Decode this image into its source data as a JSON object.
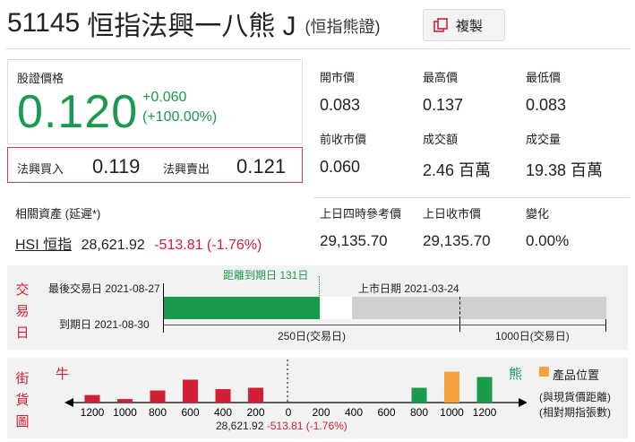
{
  "header": {
    "code": "51145",
    "name": "恒指法興一八熊 J",
    "paren": "(恒指熊證)",
    "copy_label": "複製"
  },
  "price": {
    "label": "股證價格",
    "value": "0.120",
    "change": "+0.060",
    "change_pct": "(+100.00%)"
  },
  "bidask": {
    "bid_label": "法興買入",
    "bid_value": "0.119",
    "ask_label": "法興賣出",
    "ask_value": "0.121"
  },
  "stats": {
    "open_label": "開市價",
    "open": "0.083",
    "high_label": "最高價",
    "high": "0.137",
    "low_label": "最低價",
    "low": "0.083",
    "prev_label": "前收市價",
    "prev": "0.060",
    "turnover_label": "成交額",
    "turnover": "2.46 百萬",
    "volume_label": "成交量",
    "volume": "19.38 百萬"
  },
  "related": {
    "label": "相關資產 (延遲*)",
    "asset": "HSI 恒指",
    "value": "28,621.92",
    "change": "-513.81 (-1.76%)",
    "ref_label": "上日四時參考價",
    "ref": "29,135.70",
    "close_label": "上日收市價",
    "close": "29,135.70",
    "diff_label": "變化",
    "diff": "0.00%"
  },
  "trading": {
    "side": [
      "交",
      "易",
      "日"
    ],
    "last_trade": "最後交易日 2021-08-27",
    "days_to_expiry": "距離到期日 131日",
    "listing": "上市日期 2021-03-24",
    "expiry": "到期日 2021-08-30",
    "scale_250": "250日(交易日)",
    "scale_1000": "1000日(交易日)",
    "progress_fraction": 0.48
  },
  "street": {
    "side": [
      "街",
      "貨",
      "圖"
    ],
    "bull": "牛",
    "bear": "熊",
    "legend": "產品位置",
    "note1": "(與現貨價距離)",
    "note2": "(相對期指張數)",
    "center_value": "28,621.92",
    "center_change": "-513.81 (-1.76%)",
    "colors": {
      "bull": "#d21f35",
      "bear": "#1a9a4c",
      "product": "#f4a340"
    }
  },
  "chart_data": {
    "type": "bar",
    "categories": [
      "1200",
      "1000",
      "800",
      "600",
      "400",
      "200",
      "0",
      "200",
      "400",
      "600",
      "800",
      "1000",
      "1200"
    ],
    "series": [
      {
        "values": [
          0.28,
          0.13,
          0.45,
          0.85,
          0.5,
          0.55,
          0,
          0,
          0,
          0,
          0.55,
          1.15,
          0.95
        ]
      }
    ],
    "bar_colors": [
      "#d21f35",
      "#d21f35",
      "#d21f35",
      "#d21f35",
      "#d21f35",
      "#d21f35",
      "",
      "",
      "",
      "",
      "#1a9a4c",
      "#f4a340",
      "#1a9a4c"
    ],
    "xlabel": "",
    "ylabel": ""
  }
}
